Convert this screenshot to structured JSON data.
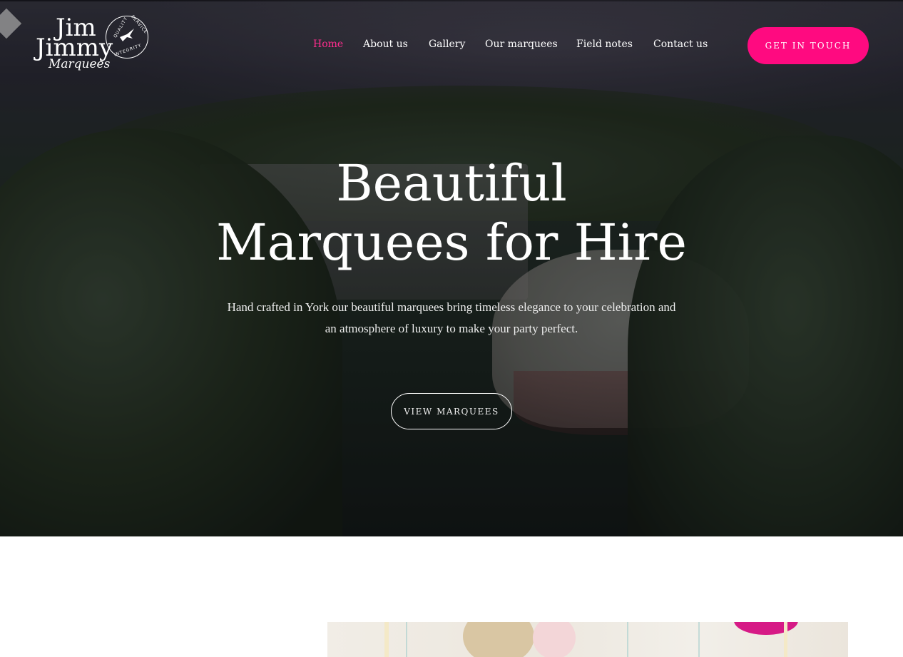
{
  "logo": {
    "line1": "Jim",
    "line2": "Jimmy",
    "line3": "Marquees",
    "badge_words": [
      "QUALITY",
      "SERVICE",
      "INTEGRITY"
    ]
  },
  "nav": {
    "items": [
      {
        "label": "Home",
        "active": true
      },
      {
        "label": "About us",
        "active": false
      },
      {
        "label": "Gallery",
        "active": false
      },
      {
        "label": "Our marquees",
        "active": false
      },
      {
        "label": "Field notes",
        "active": false
      },
      {
        "label": "Contact us",
        "active": false
      }
    ]
  },
  "cta_label": "GET IN TOUCH",
  "hero": {
    "title_line1": "Beautiful",
    "title_line2": "Marquees for Hire",
    "subtitle_line1": "Hand crafted in York our beautiful marquees bring timeless elegance to your celebration and",
    "subtitle_line2": "an atmosphere of luxury to make your party perfect.",
    "button_label": "VIEW MARQUEES"
  },
  "colors": {
    "accent": "#ff0a80",
    "nav_active": "#ff2d8e",
    "text_light": "#ffffff"
  }
}
